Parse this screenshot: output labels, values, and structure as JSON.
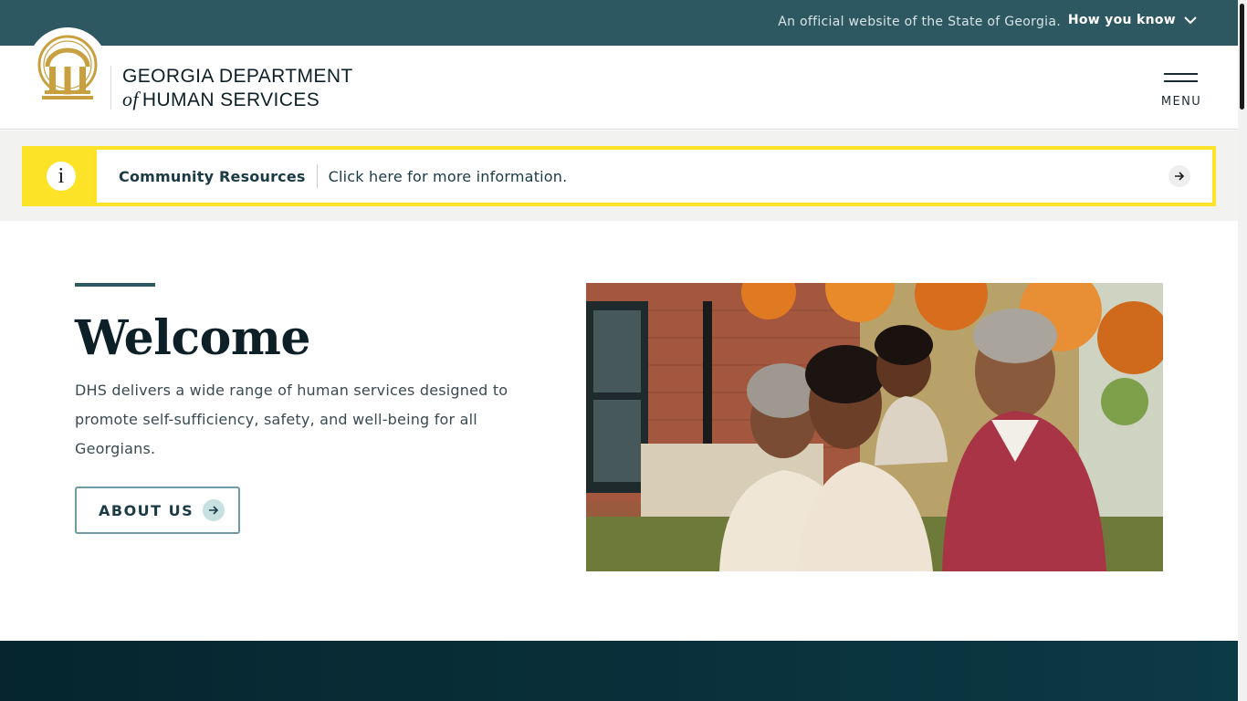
{
  "official_banner": {
    "text": "An official website of the State of Georgia.",
    "how_you_know": "How you know"
  },
  "header": {
    "brand_line1": "GEORGIA DEPARTMENT",
    "brand_of": "of",
    "brand_line2": "HUMAN SERVICES",
    "menu_label": "MENU"
  },
  "alert": {
    "title": "Community Resources",
    "message": "Click here for more information.",
    "icon_glyph": "i",
    "color": "#fde327"
  },
  "welcome": {
    "title": "Welcome",
    "body": "DHS delivers a wide range of human services designed to promote self-sufficiency, safety, and well-being for all Georgians.",
    "button_label": "ABOUT US"
  },
  "colors": {
    "primary_teal": "#2e5861",
    "alert_yellow": "#fde327",
    "seal_gold": "#c9a040",
    "footer_dark": "#06252e"
  }
}
